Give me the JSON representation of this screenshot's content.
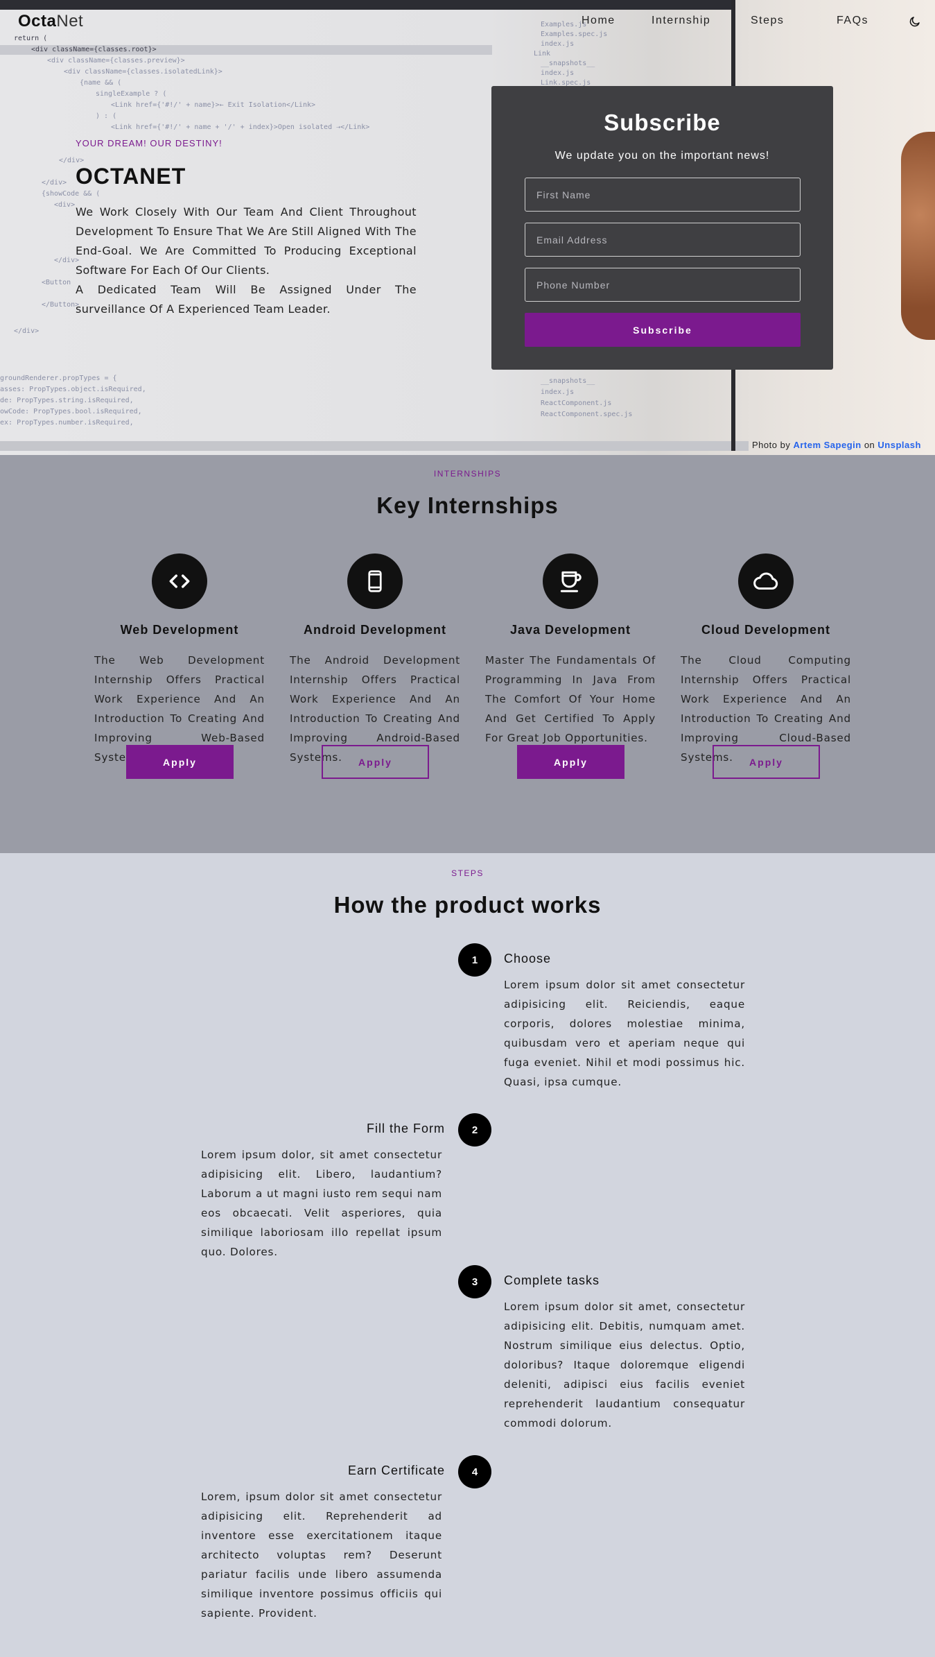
{
  "nav": {
    "logo_bold": "Octa",
    "logo_light": "Net",
    "links": [
      "Home",
      "Internship",
      "Steps",
      "FAQs"
    ],
    "theme_icon": "moon-icon"
  },
  "hero": {
    "tagline": "YOUR DREAM! OUR DESTINY!",
    "title": "OCTANET",
    "paragraph1": "We Work Closely With Our Team And Client Throughout Development To Ensure That We Are Still Aligned With The End-Goal. We Are Committed To Producing Exceptional Software For Each Of Our Clients.",
    "paragraph2": "A Dedicated Team Will Be Assigned Under The surveillance Of A Experienced Team Leader.",
    "photo_credit": {
      "prefix": "Photo by",
      "author": "Artem Sapegin",
      "middle": "on",
      "site": "Unsplash"
    }
  },
  "subscribe": {
    "title": "Subscribe",
    "subtitle": "We update you on the important news!",
    "first_name_placeholder": "First Name",
    "email_placeholder": "Email Address",
    "phone_placeholder": "Phone Number",
    "button": "Subscribe"
  },
  "internships": {
    "eyebrow": "INTERNSHIPS",
    "title": "Key Internships",
    "cards": [
      {
        "icon": "code-icon",
        "title": "Web Development",
        "text": "The Web Development Internship Offers Practical Work Experience And An Introduction To Creating And Improving Web-Based Systems.",
        "button": "Apply",
        "style": "solid"
      },
      {
        "icon": "mobile-phone-icon",
        "title": "Android Development",
        "text": "The Android Development Internship Offers Practical Work Experience And An Introduction To Creating And Improving Android-Based Systems.",
        "button": "Apply",
        "style": "outline"
      },
      {
        "icon": "coffee-cup-icon",
        "title": "Java Development",
        "text": "Master The Fundamentals Of Programming In Java From The Comfort Of Your Home And Get Certified To Apply For Great Job Opportunities.",
        "button": "Apply",
        "style": "solid"
      },
      {
        "icon": "cloud-icon",
        "title": "Cloud Development",
        "text": "The Cloud Computing Internship Offers Practical Work Experience And An Introduction To Creating And Improving Cloud-Based Systems.",
        "button": "Apply",
        "style": "outline"
      }
    ]
  },
  "steps": {
    "eyebrow": "STEPS",
    "title": "How the product works",
    "items": [
      {
        "number": "1",
        "title": "Choose",
        "text": "Lorem ipsum dolor sit amet consectetur adipisicing elit. Reiciendis, eaque corporis, dolores molestiae minima, quibusdam vero et aperiam neque qui fuga eveniet. Nihil et modi possimus hic. Quasi, ipsa cumque."
      },
      {
        "number": "2",
        "title": "Fill the Form",
        "text": "Lorem ipsum dolor, sit amet consectetur adipisicing elit. Libero, laudantium? Laborum a ut magni iusto rem sequi nam eos obcaecati. Velit asperiores, quia similique laboriosam illo repellat ipsum quo. Dolores."
      },
      {
        "number": "3",
        "title": "Complete tasks",
        "text": "Lorem ipsum dolor sit amet, consectetur adipisicing elit. Debitis, numquam amet. Nostrum similique eius delectus. Optio, doloribus? Itaque doloremque eligendi deleniti, adipisci eius facilis eveniet reprehenderit laudantium consequatur commodi dolorum."
      },
      {
        "number": "4",
        "title": "Earn Certificate",
        "text": "Lorem, ipsum dolor sit amet consectetur adipisicing elit. Reprehenderit ad inventore esse exercitationem itaque architecto voluptas rem? Deserunt pariatur facilis unde libero assumenda similique inventore possimus officiis qui sapiente. Provident."
      }
    ]
  },
  "colors": {
    "accent": "#7b1a8e",
    "hero_bg": "#e4e4e6",
    "card_bg": "#3f3f42",
    "internships_bg": "#9a9ca6",
    "steps_bg": "#d2d5de"
  }
}
